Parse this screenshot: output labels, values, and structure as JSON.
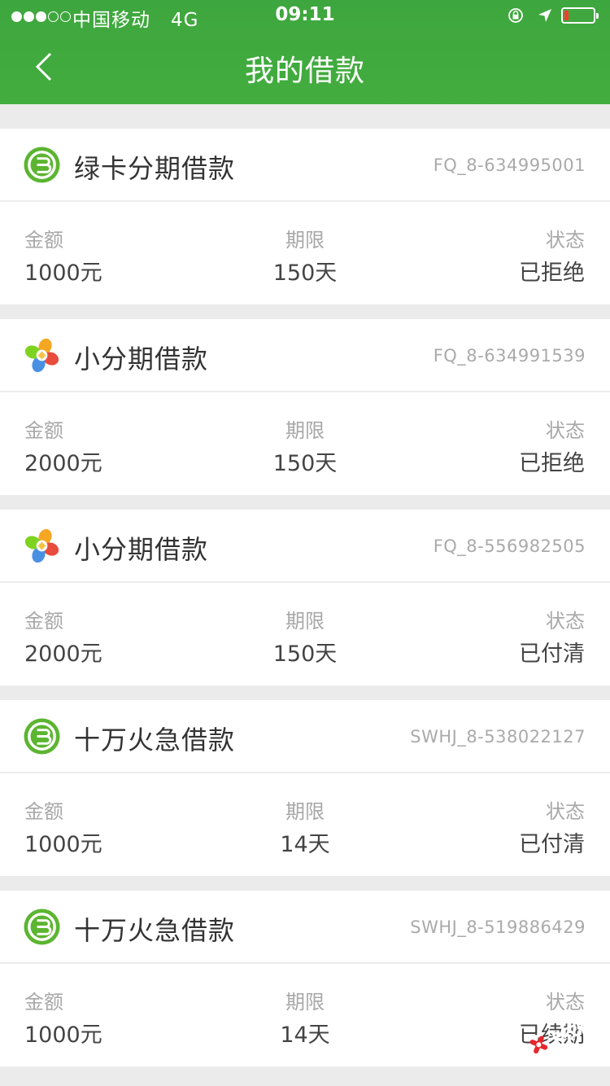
{
  "status_bar": {
    "carrier": "中国移动",
    "network": "4G",
    "time": "09:11",
    "signal_bars_filled": 3,
    "signal_bars_total": 5,
    "battery_level": 0.1
  },
  "header": {
    "title": "我的借款",
    "back_icon": "chevron-left-icon"
  },
  "labels": {
    "amount": "金额",
    "term": "期限",
    "status": "状态"
  },
  "loans": [
    {
      "name": "绿卡分期借款",
      "code": "FQ_8-634995001",
      "amount": "1000元",
      "term": "150天",
      "status": "已拒绝",
      "logo": "green-card-logo-icon"
    },
    {
      "name": "小分期借款",
      "code": "FQ_8-634991539",
      "amount": "2000元",
      "term": "150天",
      "status": "已拒绝",
      "logo": "pinwheel-logo-icon"
    },
    {
      "name": "小分期借款",
      "code": "FQ_8-556982505",
      "amount": "2000元",
      "term": "150天",
      "status": "已付清",
      "logo": "pinwheel-logo-icon"
    },
    {
      "name": "十万火急借款",
      "code": "SWHJ_8-538022127",
      "amount": "1000元",
      "term": "14天",
      "status": "已付清",
      "logo": "green-card-logo-icon"
    },
    {
      "name": "十万火急借款",
      "code": "SWHJ_8-519886429",
      "amount": "1000元",
      "term": "14天",
      "status": "已续期",
      "logo": "green-card-logo-icon"
    }
  ],
  "watermark": {
    "text": "卡农社区"
  },
  "colors": {
    "header_green": "#43ad3f",
    "background": "#ebebeb",
    "battery_low": "#ff3b30"
  }
}
